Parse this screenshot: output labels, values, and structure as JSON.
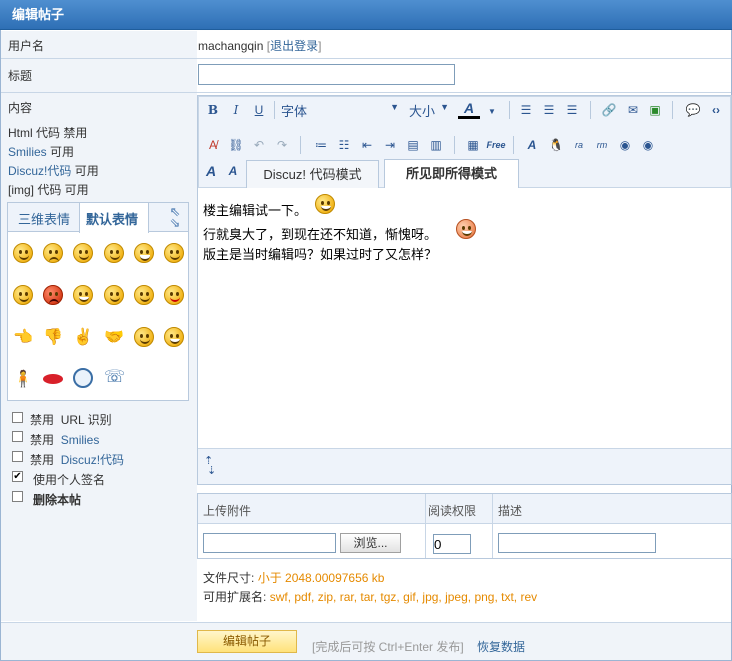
{
  "header": {
    "title": "编辑帖子"
  },
  "username_row": {
    "label": "用户名",
    "username": "machangqin",
    "bracket_open": "[",
    "logout": "退出登录",
    "bracket_close": "]"
  },
  "title_row": {
    "label": "标题",
    "value": ""
  },
  "content_row": {
    "label": "内容",
    "html_line": "Html 代码 禁用",
    "smilies_link": "Smilies",
    "smilies_state": "可用",
    "discuz_link": "Discuz!代码",
    "discuz_state": "可用",
    "img_line": "[img] 代码 可用"
  },
  "smiley_tabs": {
    "tab1": "三维表情",
    "tab2": "默认表情"
  },
  "editor": {
    "font_label": "字体",
    "size_label": "大小",
    "tab_code": "Discuz! 代码模式",
    "tab_wysiwyg": "所见即所得模式",
    "lines": [
      "楼主编辑试一下。",
      "行就臭大了，到现在还不知道，惭愧呀。",
      "版主是当时编辑吗？如果过时了又怎样？"
    ]
  },
  "options": [
    {
      "text_a": "禁用",
      "text_b": "URL 识别",
      "checked": false
    },
    {
      "text_a": "禁用",
      "text_b": "Smilies",
      "checked": false
    },
    {
      "text_a": "禁用",
      "text_b": "Discuz!代码",
      "checked": false
    },
    {
      "text_a": "使用个人签名",
      "text_b": "",
      "checked": true
    },
    {
      "text_a": "删除本帖",
      "text_b": "",
      "checked": false
    }
  ],
  "attachments": {
    "col_upload": "上传附件",
    "col_perm": "阅读权限",
    "col_desc": "描述",
    "browse": "浏览...",
    "perm_value": "0",
    "size_label": "文件尺寸:",
    "size_value": "小于 2048.00097656 kb",
    "ext_label": "可用扩展名:",
    "ext_value": "swf, pdf, zip, rar, tar, tgz, gif, jpg, jpeg, png, txt, rev"
  },
  "footer": {
    "submit": "编辑帖子",
    "hint": "[完成后可按 Ctrl+Enter 发布]",
    "restore": "恢复数据"
  },
  "colors": {
    "accent": "#2e6fb5",
    "link": "#336699",
    "orange": "#e58a00"
  }
}
